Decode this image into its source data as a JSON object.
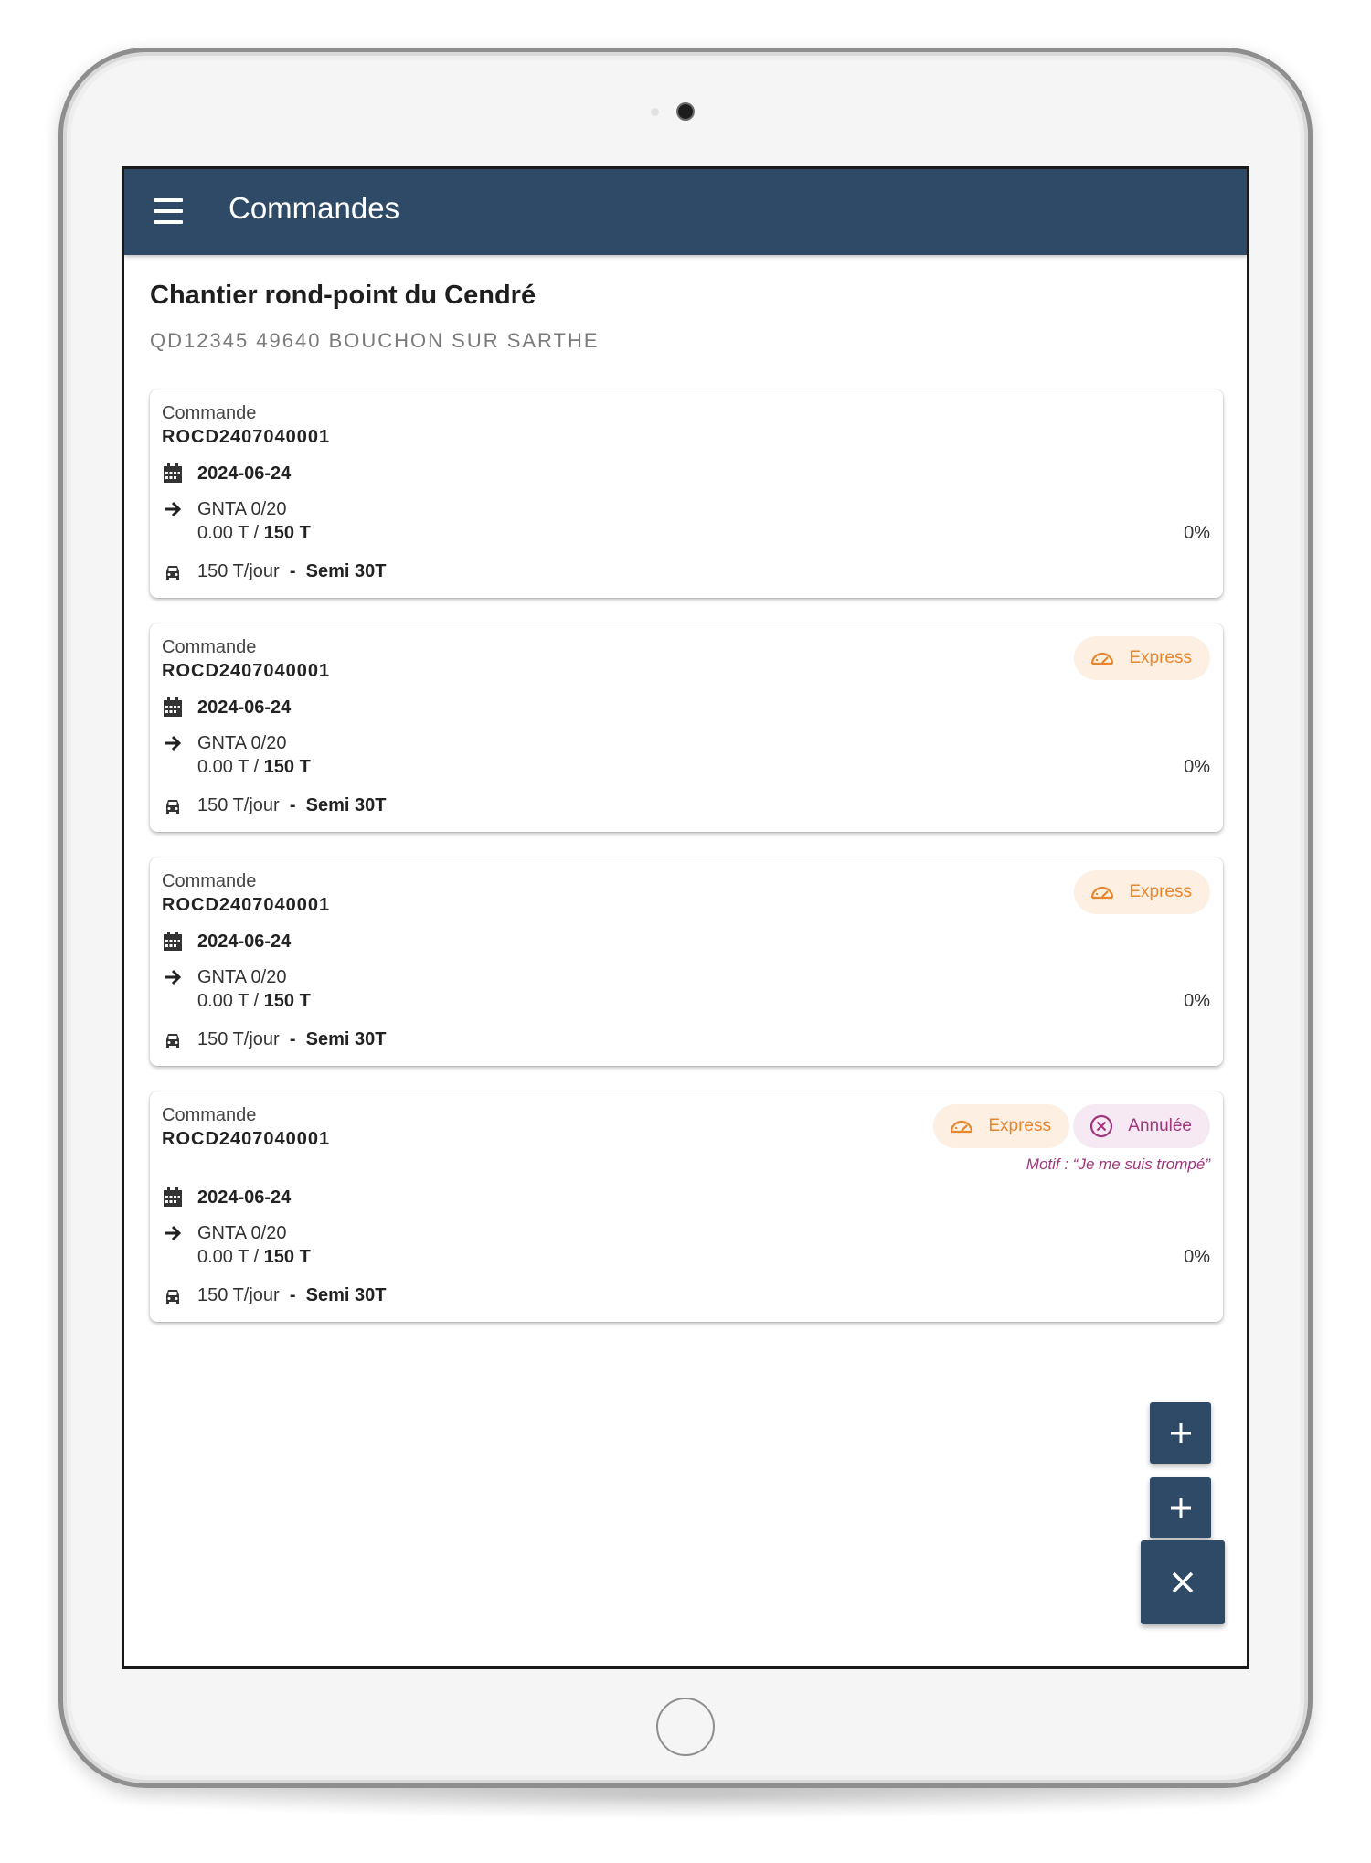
{
  "app": {
    "title": "Commandes",
    "menu_icon": "hamburger-menu-icon",
    "primary_color": "#2e4a67"
  },
  "site": {
    "name": "Chantier rond-point du Cendré",
    "address": "QD12345 49640 BOUCHON SUR SARTHE"
  },
  "orders": [
    {
      "label": "Commande",
      "reference": "ROCD2407040001",
      "date": "2024-06-24",
      "product": "GNTA 0/20",
      "quantity_done": "0.00 T",
      "quantity_sep": " / ",
      "quantity_total": "150 T",
      "progress": "0%",
      "rate": "150 T/jour",
      "dash": "-",
      "vehicle": "Semi 30T"
    },
    {
      "label": "Commande",
      "reference": "ROCD2407040001",
      "date": "2024-06-24",
      "product": "GNTA 0/20",
      "quantity_done": "0.00 T",
      "quantity_sep": " / ",
      "quantity_total": "150 T",
      "progress": "0%",
      "rate": "150 T/jour",
      "dash": "-",
      "vehicle": "Semi 30T",
      "badge_express": "Express"
    },
    {
      "label": "Commande",
      "reference": "ROCD2407040001",
      "date": "2024-06-24",
      "product": "GNTA 0/20",
      "quantity_done": "0.00 T",
      "quantity_sep": " / ",
      "quantity_total": "150 T",
      "progress": "0%",
      "rate": "150 T/jour",
      "dash": "-",
      "vehicle": "Semi 30T",
      "badge_express": "Express"
    },
    {
      "label": "Commande",
      "reference": "ROCD2407040001",
      "date": "2024-06-24",
      "product": "GNTA 0/20",
      "quantity_done": "0.00 T",
      "quantity_sep": " / ",
      "quantity_total": "150 T",
      "progress": "0%",
      "rate": "150 T/jour",
      "dash": "-",
      "vehicle": "Semi 30T",
      "badge_express": "Express",
      "badge_cancelled": "Annulée",
      "motif": "Motif : “Je me suis trompé”"
    }
  ],
  "badge_colors": {
    "express_text": "#e8862e",
    "express_bg": "#fdefe2",
    "cancelled_text": "#a0367c",
    "cancelled_bg": "#f7e9f3"
  },
  "fab": {
    "add_icon": "plus-icon",
    "close_icon": "close-icon"
  }
}
